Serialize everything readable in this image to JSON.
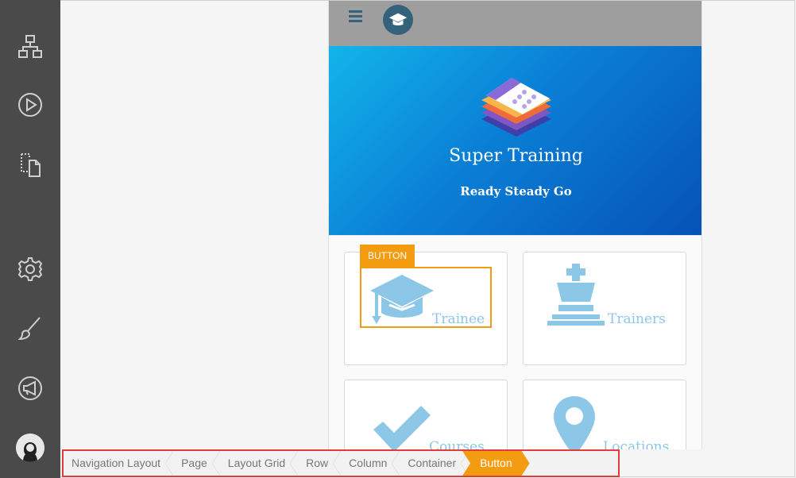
{
  "sidebar": {
    "icons": [
      "sitemap-icon",
      "play-icon",
      "page-copy-icon",
      "gear-icon",
      "brush-icon",
      "megaphone-icon",
      "avatar-icon"
    ]
  },
  "app": {
    "title": "Super Training",
    "subtitle": "Ready Steady Go"
  },
  "tiles": {
    "trainee": "Trainee",
    "trainers": "Trainers",
    "courses": "Courses",
    "locations": "Locations"
  },
  "selection": {
    "tag": "BUTTON"
  },
  "breadcrumb": {
    "items": [
      "Navigation Layout",
      "Page",
      "Layout Grid",
      "Row",
      "Column",
      "Container",
      "Button"
    ]
  },
  "colors": {
    "sidebar": "#4a4a4a",
    "accent": "#f39c12",
    "icon_blue": "#8cc7e8",
    "hero_start": "#12b5ea",
    "hero_end": "#0652b7",
    "breadcrumb_border": "#e33b3b"
  }
}
